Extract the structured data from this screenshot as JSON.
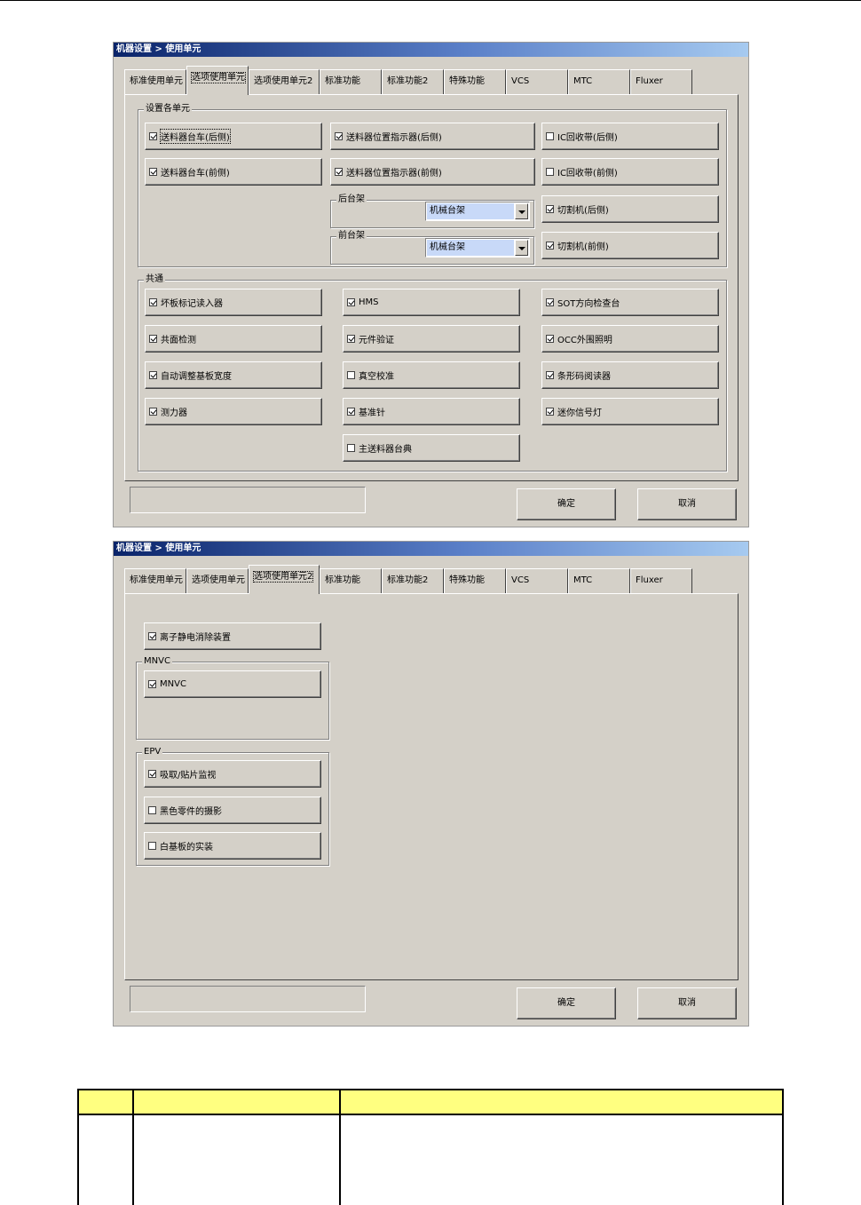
{
  "dialog1": {
    "title": "机器设置 > 使用单元",
    "tabs": [
      "标准使用单元",
      "选项使用单元",
      "选项使用单元2",
      "标准功能",
      "标准功能2",
      "特殊功能",
      "VCS",
      "MTC",
      "Fluxer"
    ],
    "active_tab": "选项使用单元",
    "group_units": {
      "label": "设置各单元",
      "col1": [
        {
          "label": "送料器台车(后侧)",
          "checked": true
        },
        {
          "label": "送料器台车(前侧)",
          "checked": true
        }
      ],
      "col2": [
        {
          "label": "送料器位置指示器(后侧)",
          "checked": true
        },
        {
          "label": "送料器位置指示器(前侧)",
          "checked": true
        }
      ],
      "rear_frame": {
        "label": "后台架",
        "value": "机械台架"
      },
      "front_frame": {
        "label": "前台架",
        "value": "机械台架"
      },
      "col3": [
        {
          "label": "IC回收带(后侧)",
          "checked": false
        },
        {
          "label": "IC回收带(前侧)",
          "checked": false
        },
        {
          "label": "切割机(后侧)",
          "checked": true
        },
        {
          "label": "切割机(前侧)",
          "checked": true
        }
      ]
    },
    "group_common": {
      "label": "共通",
      "col1": [
        {
          "label": "坏板标记读入器",
          "checked": true
        },
        {
          "label": "共面检测",
          "checked": true
        },
        {
          "label": "自动调整基板宽度",
          "checked": true
        },
        {
          "label": "测力器",
          "checked": true
        }
      ],
      "col2": [
        {
          "label": "HMS",
          "checked": true
        },
        {
          "label": "元件验证",
          "checked": true
        },
        {
          "label": "真空校准",
          "checked": false
        },
        {
          "label": "基准针",
          "checked": true
        },
        {
          "label": "主送料器台典",
          "checked": false
        }
      ],
      "col3": [
        {
          "label": "SOT方向检查台",
          "checked": true
        },
        {
          "label": "OCC外围照明",
          "checked": true
        },
        {
          "label": "条形码阅读器",
          "checked": true
        },
        {
          "label": "迷你信号灯",
          "checked": true
        }
      ]
    },
    "ok_label": "确定",
    "cancel_label": "取消"
  },
  "dialog2": {
    "title": "机器设置 > 使用单元",
    "tabs": [
      "标准使用单元",
      "选项使用单元",
      "选项使用单元2",
      "标准功能",
      "标准功能2",
      "特殊功能",
      "VCS",
      "MTC",
      "Fluxer"
    ],
    "active_tab": "选项使用单元2",
    "ion_item": {
      "label": "离子静电消除装置",
      "checked": true
    },
    "group_mnvc": {
      "label": "MNVC",
      "items": [
        {
          "label": "MNVC",
          "checked": true
        }
      ]
    },
    "group_epv": {
      "label": "EPV",
      "items": [
        {
          "label": "吸取/贴片监视",
          "checked": true
        },
        {
          "label": "黑色零件的摄影",
          "checked": false
        },
        {
          "label": "白基板的实装",
          "checked": false
        }
      ]
    },
    "ok_label": "确定",
    "cancel_label": "取消"
  }
}
